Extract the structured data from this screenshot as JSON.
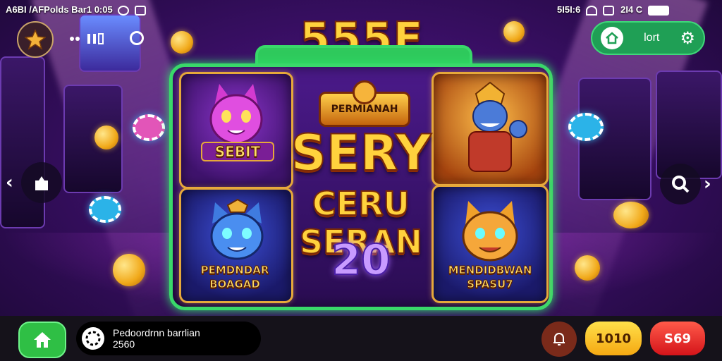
{
  "status_bar": {
    "left_text": "A6BI /AFPolds Bar1 0:05",
    "right_text": "5I5I:6",
    "battery_text": "2I4 C"
  },
  "header": {
    "logo_text": "555F",
    "top_right_label": "lort"
  },
  "panel": {
    "card1_caption": "SEBIT",
    "card2_caption": "PEMDNDAR BOAGAD",
    "card3_caption": "MENDIDBWAN SPASU7",
    "badge_text": "PERMIANAH",
    "headline_line1": "SERY",
    "headline_line2": "CERU SERAN",
    "number": "20"
  },
  "bottom_bar": {
    "info_line1": "Pedoordrnn barrlian",
    "info_line2": "2560",
    "yellow_pill_label": "1010",
    "red_pill_label": "S69"
  },
  "icons": [
    "star-logo-icon",
    "gallery-icon",
    "home-icon",
    "settings-gear-icon",
    "chevron-left-icon",
    "chevron-right-icon",
    "bag-icon",
    "search-icon",
    "wheel-icon",
    "bell-icon"
  ],
  "colors": {
    "accent_green": "#39d86a",
    "gold": "#ffd23d",
    "red": "#e52329",
    "yellow": "#ffc21a",
    "purple": "#3a0f66"
  }
}
